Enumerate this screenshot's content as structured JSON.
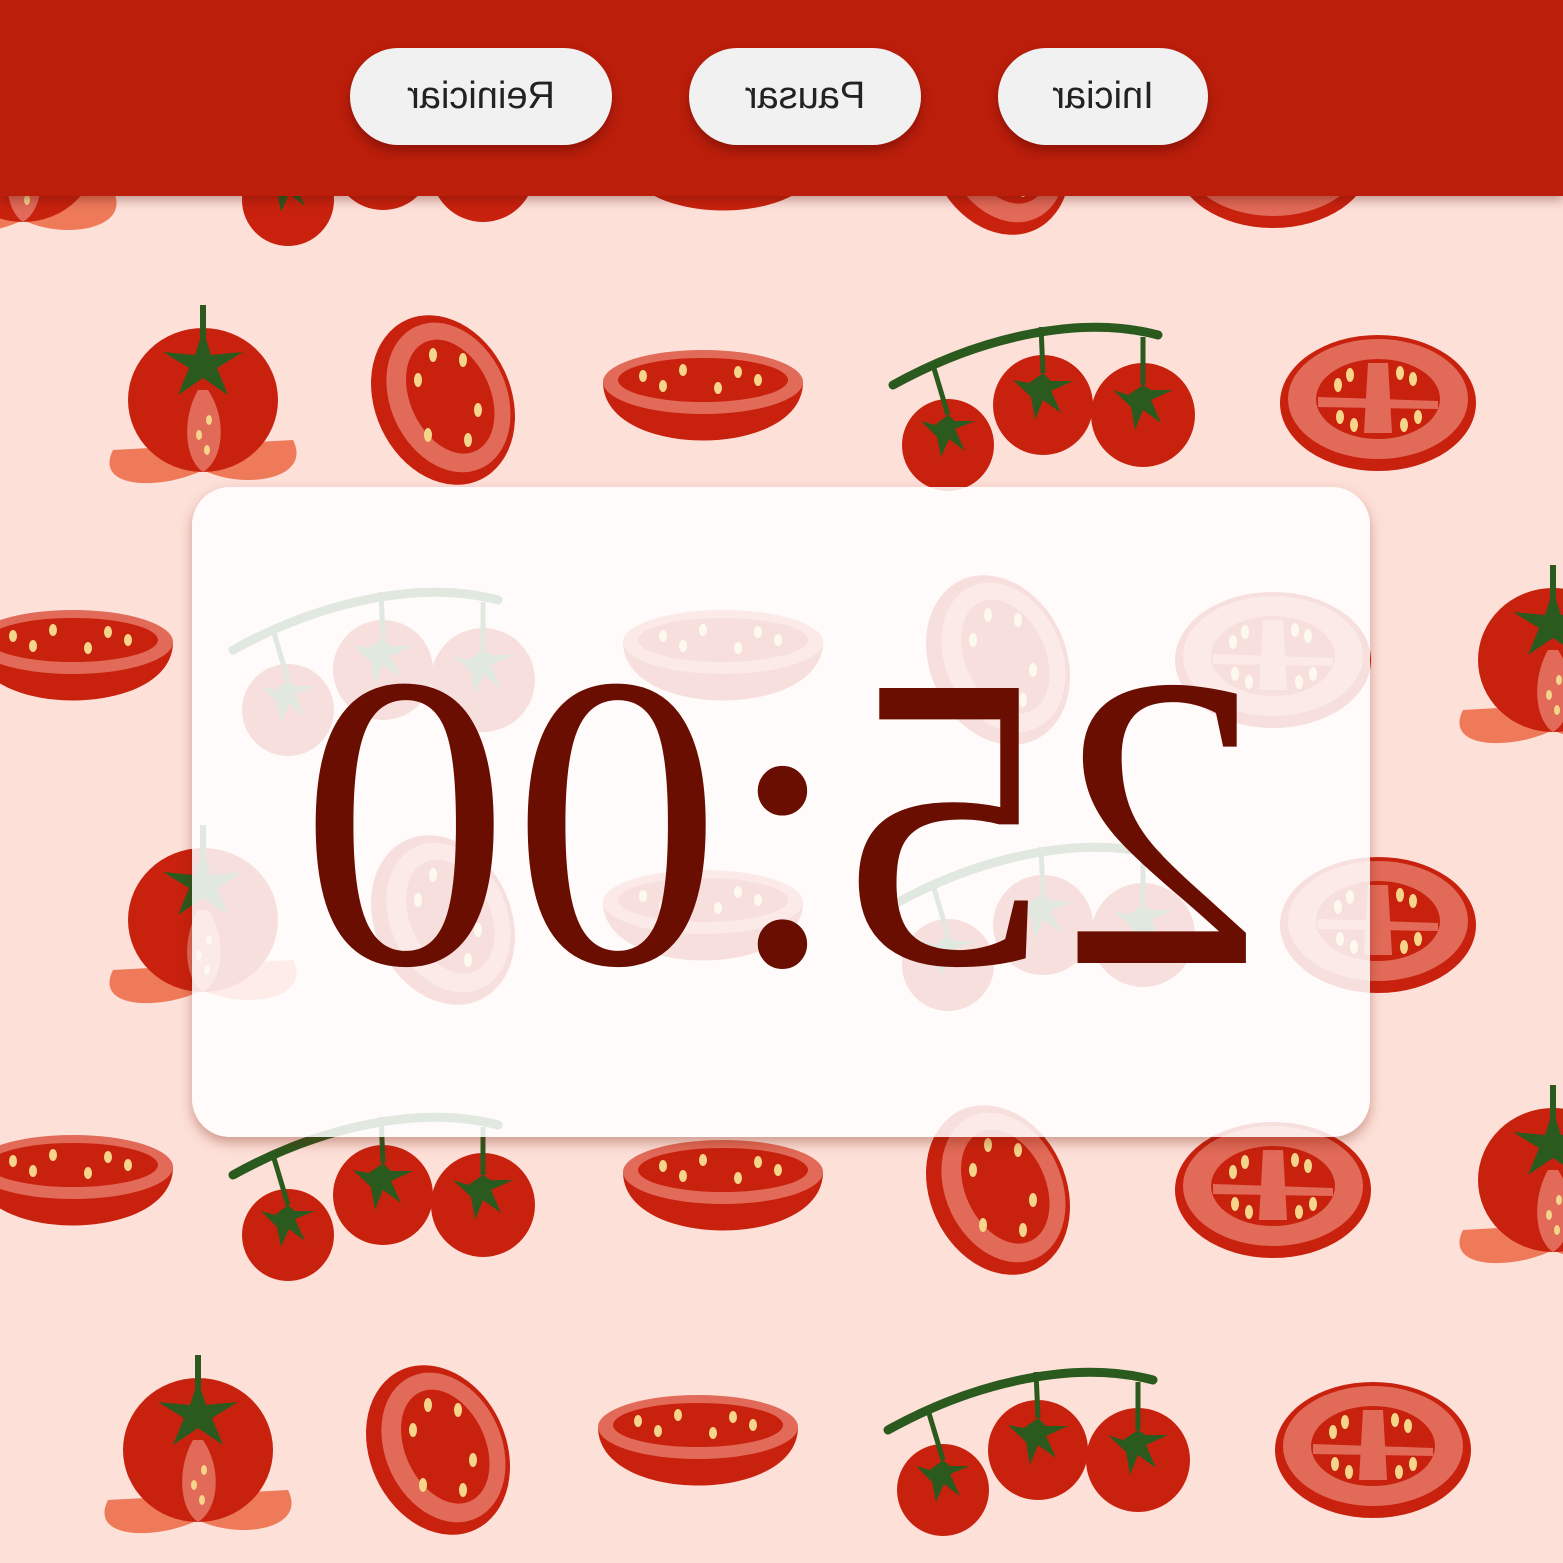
{
  "toolbar": {
    "start_label": "Iniciar",
    "pause_label": "Pausar",
    "reset_label": "Reiniciar"
  },
  "timer": {
    "display": "25:00"
  },
  "colors": {
    "header": "#bb1e0b",
    "background": "#fde0d8",
    "button": "#f1f1f1",
    "timer_text": "#6a0e02",
    "tomato": "#c8220e",
    "tomato_light": "#e26a58",
    "leaf": "#2a5a1e",
    "seed": "#f5d58a"
  },
  "background_pattern": {
    "icons": [
      "tomato-slice-icon",
      "cherry-tomato-vine-icon",
      "tomato-half-icon",
      "tomato-wedge-icon",
      "whole-tomato-icon"
    ]
  }
}
